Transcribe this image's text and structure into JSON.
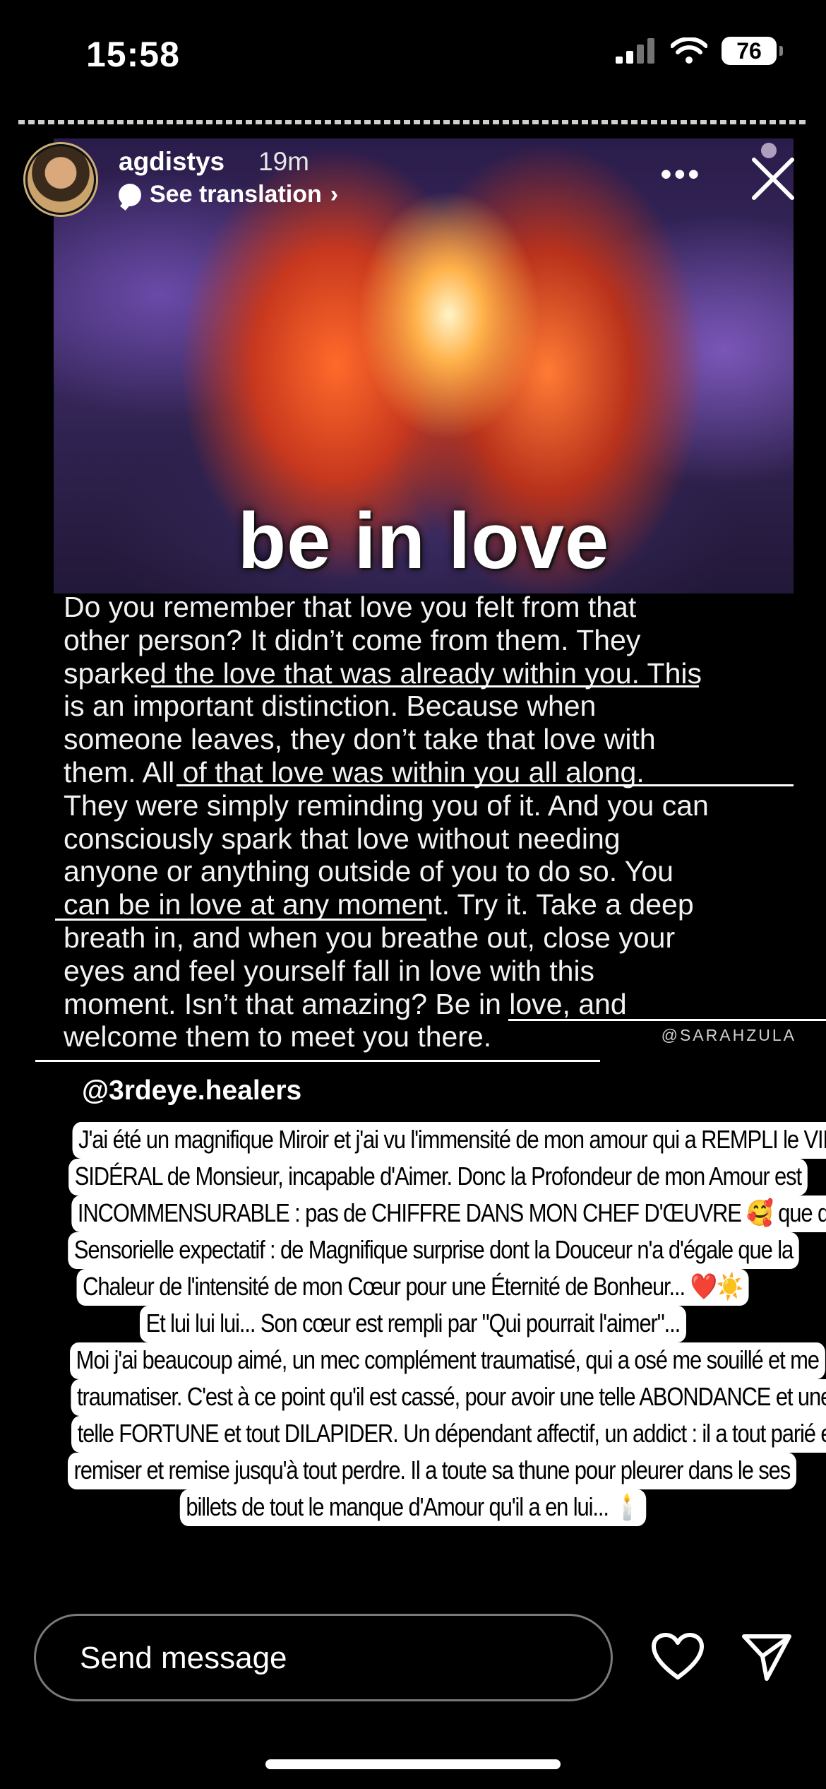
{
  "status_bar": {
    "time": "15:58",
    "battery": "76"
  },
  "story": {
    "username": "agdistys",
    "time_ago": "19m",
    "translation_label": "See translation",
    "more_label": "•••",
    "headline": "be in love",
    "quote_lines": [
      "Do you remember that love you felt from that",
      "other person? It didn’t come from them. They",
      "sparked the love that was already within you. This",
      "is an important distinction. Because when",
      "someone leaves, they don’t take that love with",
      "them. All of that love was within you all along.",
      "They were simply reminding you of it. And you can",
      "consciously spark that love without needing",
      "anyone or anything outside of you to do so. You",
      "can be in love at any moment. Try it. Take a deep",
      "breath in, and when you breathe out, close your",
      "eyes and feel yourself fall in love with this",
      "moment. Isn’t that amazing? Be in love, and",
      "welcome them to meet you there."
    ],
    "quote_credit": "@SARAHZULA",
    "mention": "@3rdeye.healers",
    "caption_lines": [
      "J'ai été un magnifique Miroir et j'ai vu l'immensité de mon amour qui a REMPLI le VIDE",
      "SIDÉRAL de Monsieur, incapable d'Aimer. Donc la Profondeur de mon Amour est",
      "INCOMMENSURABLE : pas de CHIFFRE DANS MON CHEF D'ŒUVRE 🥰 que du",
      "Sensorielle expectatif : de Magnifique surprise dont la Douceur n'a d'égale que la",
      "Chaleur de l'intensité de mon Cœur pour une Éternité de Bonheur... ❤️☀️",
      "Et lui lui lui... Son cœur est rempli par \"Qui pourrait l'aimer\"...",
      "Moi j'ai beaucoup aimé, un mec complément traumatisé, qui a osé me souillé et me",
      "traumatiser. C'est à ce point qu'il est cassé, pour avoir une telle ABONDANCE et une",
      "telle FORTUNE et tout DILAPIDER. Un dépendant affectif, un addict : il a tout parié et",
      "remiser et remise jusqu'à tout perdre. Il a toute sa thune pour pleurer dans le ses",
      "billets de tout le manque d'Amour qu'il a en lui... 🕯️"
    ]
  },
  "bottom_bar": {
    "message_placeholder": "Send message"
  }
}
